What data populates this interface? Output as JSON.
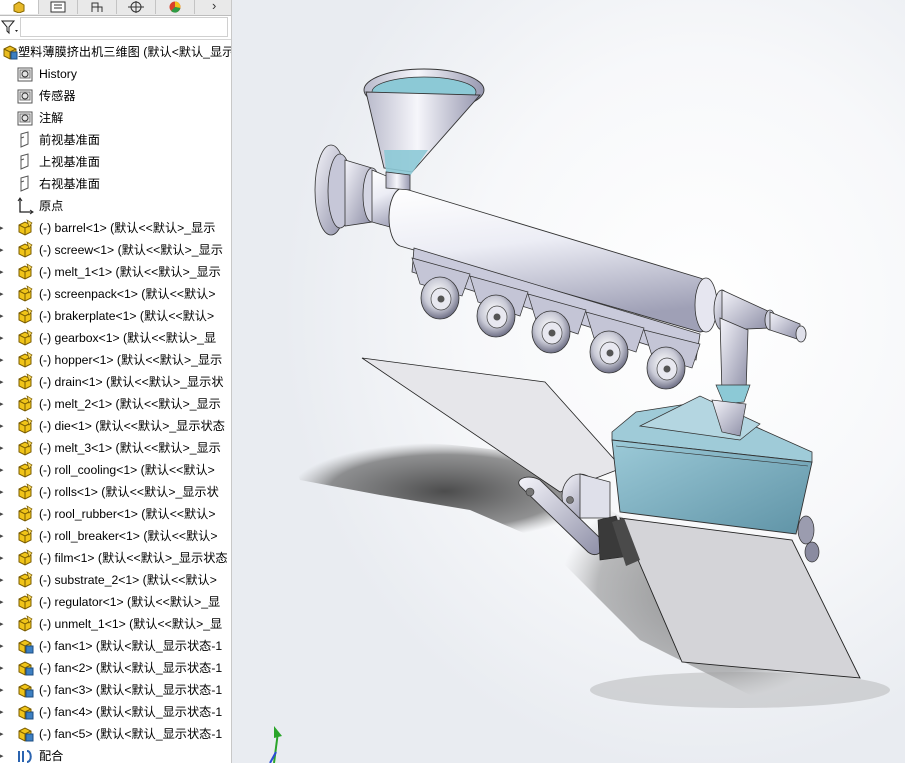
{
  "tabs": [
    {
      "name": "feature-manager",
      "icon": "feature-manager-icon"
    },
    {
      "name": "property-manager",
      "icon": "property-manager-icon"
    },
    {
      "name": "configuration-manager",
      "icon": "configuration-manager-icon"
    },
    {
      "name": "dimxpert-manager",
      "icon": "dimxpert-icon"
    },
    {
      "name": "display-manager",
      "icon": "display-manager-icon"
    }
  ],
  "tree": {
    "root_label": "塑料薄膜挤出机三维图 (默认<默认_显示",
    "items": [
      {
        "label": "History",
        "icon": "history-folder-icon",
        "kind": "folder"
      },
      {
        "label": "传感器",
        "icon": "sensor-folder-icon",
        "kind": "folder"
      },
      {
        "label": "注解",
        "icon": "annotation-folder-icon",
        "kind": "folder"
      },
      {
        "label": "前视基准面",
        "icon": "plane-icon",
        "kind": "plane"
      },
      {
        "label": "上视基准面",
        "icon": "plane-icon",
        "kind": "plane"
      },
      {
        "label": "右视基准面",
        "icon": "plane-icon",
        "kind": "plane"
      },
      {
        "label": "原点",
        "icon": "origin-icon",
        "kind": "origin"
      },
      {
        "label": "(-) barrel<1> (默认<<默认>_显示",
        "icon": "part-icon",
        "kind": "part"
      },
      {
        "label": "(-) screew<1> (默认<<默认>_显示",
        "icon": "part-icon",
        "kind": "part"
      },
      {
        "label": "(-) melt_1<1> (默认<<默认>_显示",
        "icon": "part-icon",
        "kind": "part"
      },
      {
        "label": "(-) screenpack<1> (默认<<默认>",
        "icon": "part-icon",
        "kind": "part"
      },
      {
        "label": "(-) brakerplate<1> (默认<<默认>",
        "icon": "part-icon",
        "kind": "part"
      },
      {
        "label": "(-) gearbox<1> (默认<<默认>_显",
        "icon": "part-icon",
        "kind": "part"
      },
      {
        "label": "(-) hopper<1> (默认<<默认>_显示",
        "icon": "part-icon",
        "kind": "part"
      },
      {
        "label": "(-) drain<1> (默认<<默认>_显示状",
        "icon": "part-icon",
        "kind": "part"
      },
      {
        "label": "(-) melt_2<1> (默认<<默认>_显示",
        "icon": "part-icon",
        "kind": "part"
      },
      {
        "label": "(-) die<1> (默认<<默认>_显示状态",
        "icon": "part-icon",
        "kind": "part"
      },
      {
        "label": "(-) melt_3<1> (默认<<默认>_显示",
        "icon": "part-icon",
        "kind": "part"
      },
      {
        "label": "(-) roll_cooling<1> (默认<<默认>",
        "icon": "part-icon",
        "kind": "part"
      },
      {
        "label": "(-) rolls<1> (默认<<默认>_显示状",
        "icon": "part-icon",
        "kind": "part"
      },
      {
        "label": "(-) rool_rubber<1> (默认<<默认>",
        "icon": "part-icon",
        "kind": "part"
      },
      {
        "label": "(-) roll_breaker<1> (默认<<默认>",
        "icon": "part-icon",
        "kind": "part"
      },
      {
        "label": "(-) film<1> (默认<<默认>_显示状态",
        "icon": "part-icon",
        "kind": "part"
      },
      {
        "label": "(-) substrate_2<1> (默认<<默认>",
        "icon": "part-icon",
        "kind": "part"
      },
      {
        "label": "(-) regulator<1> (默认<<默认>_显",
        "icon": "part-icon",
        "kind": "part"
      },
      {
        "label": "(-) unmelt_1<1> (默认<<默认>_显",
        "icon": "part-icon",
        "kind": "part"
      },
      {
        "label": "(-) fan<1> (默认<默认_显示状态-1",
        "icon": "assembly-icon",
        "kind": "assembly"
      },
      {
        "label": "(-) fan<2> (默认<默认_显示状态-1",
        "icon": "assembly-icon",
        "kind": "assembly"
      },
      {
        "label": "(-) fan<3> (默认<默认_显示状态-1",
        "icon": "assembly-icon",
        "kind": "assembly"
      },
      {
        "label": "(-) fan<4> (默认<默认_显示状态-1",
        "icon": "assembly-icon",
        "kind": "assembly"
      },
      {
        "label": "(-) fan<5> (默认<默认_显示状态-1",
        "icon": "assembly-icon",
        "kind": "assembly"
      },
      {
        "label": "配合",
        "icon": "mates-icon",
        "kind": "mates"
      }
    ]
  },
  "colors": {
    "part_yellow": "#f0c419",
    "assembly_blue": "#3d7fc1",
    "model_metal": "#dfe0ec",
    "model_cyan": "#8cc2d2",
    "film_gray": "#d8d8dc"
  }
}
